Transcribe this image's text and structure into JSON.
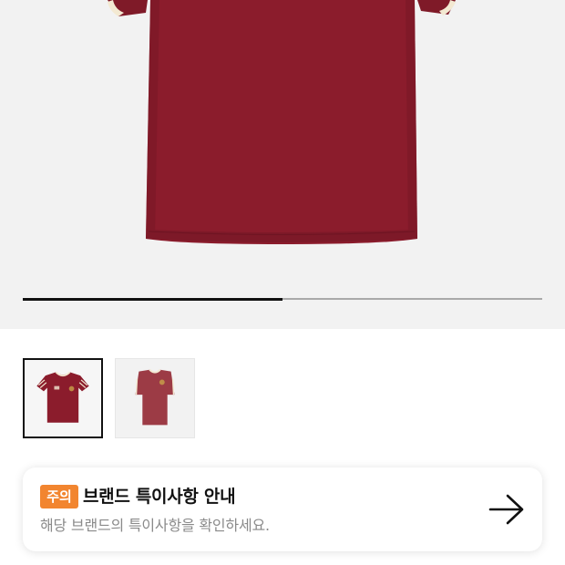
{
  "product": {
    "image_name": "burgundy-tshirt-main-image",
    "shirt_color": "#8b1c2c",
    "trim_color": "#f3e9d2"
  },
  "gallery": {
    "progress": 0.5,
    "thumbnails": [
      {
        "name": "thumbnail-front",
        "selected": true
      },
      {
        "name": "thumbnail-model",
        "selected": false
      }
    ]
  },
  "notice": {
    "badge": "주의",
    "title": "브랜드 특이사항 안내",
    "description": "해당 브랜드의 특이사항을 확인하세요.",
    "arrow_icon": "arrow-right-icon",
    "badge_color": "#f2852f"
  }
}
